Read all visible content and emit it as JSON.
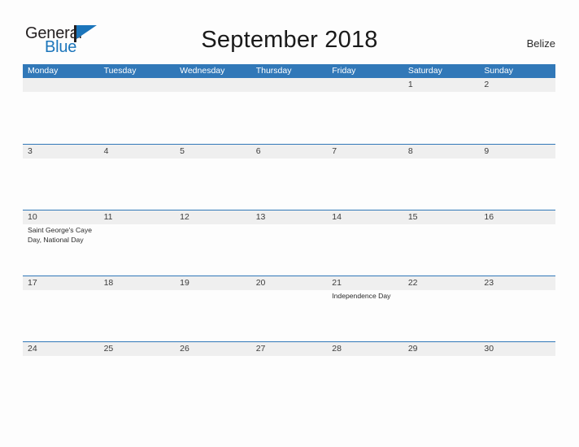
{
  "brand": {
    "name_part1": "General",
    "name_part2": "Blue",
    "flag_color": "#1b75bb"
  },
  "header": {
    "title": "September 2018",
    "region": "Belize"
  },
  "calendar": {
    "month": "September",
    "year": "2018",
    "accent_color": "#3178b8",
    "band_color": "#efefef",
    "weekday_headers": [
      "Monday",
      "Tuesday",
      "Wednesday",
      "Thursday",
      "Friday",
      "Saturday",
      "Sunday"
    ],
    "weeks": [
      {
        "days": [
          {
            "num": "",
            "events": []
          },
          {
            "num": "",
            "events": []
          },
          {
            "num": "",
            "events": []
          },
          {
            "num": "",
            "events": []
          },
          {
            "num": "",
            "events": []
          },
          {
            "num": "1",
            "events": []
          },
          {
            "num": "2",
            "events": []
          }
        ]
      },
      {
        "days": [
          {
            "num": "3",
            "events": []
          },
          {
            "num": "4",
            "events": []
          },
          {
            "num": "5",
            "events": []
          },
          {
            "num": "6",
            "events": []
          },
          {
            "num": "7",
            "events": []
          },
          {
            "num": "8",
            "events": []
          },
          {
            "num": "9",
            "events": []
          }
        ]
      },
      {
        "days": [
          {
            "num": "10",
            "events": [
              "Saint George's Caye Day, National Day"
            ]
          },
          {
            "num": "11",
            "events": []
          },
          {
            "num": "12",
            "events": []
          },
          {
            "num": "13",
            "events": []
          },
          {
            "num": "14",
            "events": []
          },
          {
            "num": "15",
            "events": []
          },
          {
            "num": "16",
            "events": []
          }
        ]
      },
      {
        "days": [
          {
            "num": "17",
            "events": []
          },
          {
            "num": "18",
            "events": []
          },
          {
            "num": "19",
            "events": []
          },
          {
            "num": "20",
            "events": []
          },
          {
            "num": "21",
            "events": [
              "Independence Day"
            ]
          },
          {
            "num": "22",
            "events": []
          },
          {
            "num": "23",
            "events": []
          }
        ]
      },
      {
        "days": [
          {
            "num": "24",
            "events": []
          },
          {
            "num": "25",
            "events": []
          },
          {
            "num": "26",
            "events": []
          },
          {
            "num": "27",
            "events": []
          },
          {
            "num": "28",
            "events": []
          },
          {
            "num": "29",
            "events": []
          },
          {
            "num": "30",
            "events": []
          }
        ]
      }
    ]
  }
}
